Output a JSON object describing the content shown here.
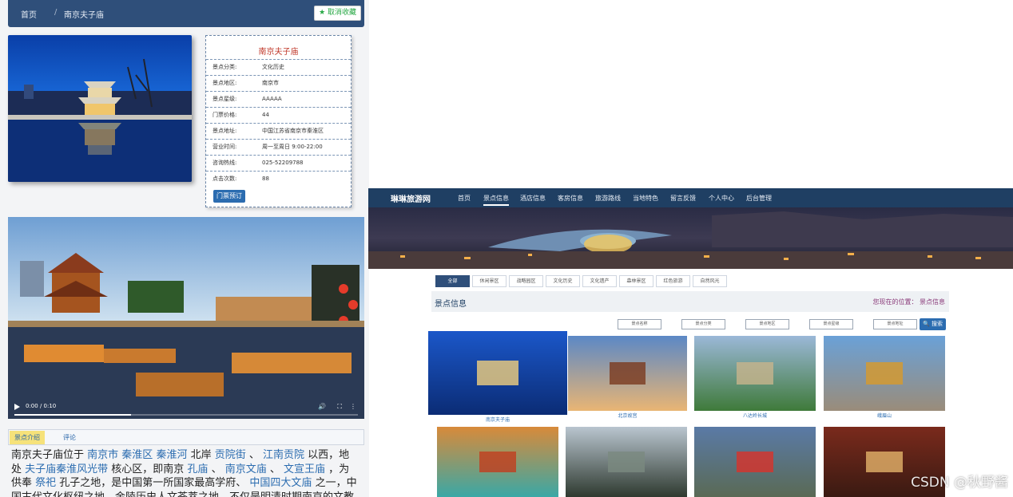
{
  "detail": {
    "breadcrumb_home": "首页",
    "breadcrumb_current": "南京夫子庙",
    "favorite_label": "★ 取消收藏",
    "info_title": "南京夫子庙",
    "info_rows": [
      {
        "k": "景点分类:",
        "v": "文化历史"
      },
      {
        "k": "景点地区:",
        "v": "南京市"
      },
      {
        "k": "景点星级:",
        "v": "AAAAA"
      },
      {
        "k": "门票价格:",
        "v": "44"
      },
      {
        "k": "景点地址:",
        "v": "中国江苏省南京市秦淮区"
      },
      {
        "k": "营业时间:",
        "v": "周一至周日 9:00-22:00"
      },
      {
        "k": "咨询热线:",
        "v": "025-52209788"
      },
      {
        "k": "点击次数:",
        "v": "88"
      }
    ],
    "book_label": "门票预订",
    "video_time": "0:00 / 0:10",
    "tab_intro": "景点介绍",
    "tab_comment": "评论",
    "intro_parts": [
      {
        "t": "南京夫子庙位于 "
      },
      {
        "t": "南京市",
        "link": true
      },
      {
        "t": " "
      },
      {
        "t": "秦淮区",
        "link": true
      },
      {
        "t": " "
      },
      {
        "t": "秦淮河",
        "link": true
      },
      {
        "t": " 北岸 "
      },
      {
        "t": "贡院街",
        "link": true
      },
      {
        "t": " 、 "
      },
      {
        "t": "江南贡院",
        "link": true
      },
      {
        "t": " 以西，地处 "
      },
      {
        "t": "夫子庙秦淮风光带",
        "link": true
      },
      {
        "t": " 核心区，即南京 "
      },
      {
        "t": "孔庙",
        "link": true
      },
      {
        "t": " 、 "
      },
      {
        "t": "南京文庙",
        "link": true
      },
      {
        "t": " 、 "
      },
      {
        "t": "文宣王庙",
        "link": true
      },
      {
        "t": " ，为供奉 "
      },
      {
        "t": "祭祀",
        "link": true
      },
      {
        "t": " 孔子之地，是中国第一所国家最高学府、 "
      },
      {
        "t": "中国四大文庙",
        "link": true
      },
      {
        "t": " 之一，中国古代文化枢纽之地、金陵历史人文荟萃之地，不仅是明清时期南京的文教中心，同"
      }
    ]
  },
  "site": {
    "brand": "琳琳旅游网",
    "nav": [
      "首页",
      "景点信息",
      "酒店信息",
      "客房信息",
      "旅游路线",
      "当地特色",
      "留言反馈",
      "个人中心",
      "后台管理"
    ],
    "nav_active": 1,
    "filters": [
      "全部",
      "休闲景区",
      "战略园区",
      "文化历史",
      "文化遗产",
      "森林景区",
      "红色旅游",
      "自然风光"
    ],
    "section_title": "景点信息",
    "location": "您现在的位置： 景点信息",
    "search_fields": [
      "景点名称",
      "景点分类",
      "景点地区",
      "景点星级",
      "景点地址"
    ],
    "search_btn": "🔍 搜索",
    "cards": [
      {
        "label": "南京夫子庙"
      },
      {
        "label": "北京故宫"
      },
      {
        "label": "八达岭长城"
      },
      {
        "label": "峨眉山"
      },
      {
        "label": ""
      },
      {
        "label": ""
      },
      {
        "label": ""
      },
      {
        "label": ""
      }
    ],
    "watermark": "CSDN @秋野酱"
  }
}
